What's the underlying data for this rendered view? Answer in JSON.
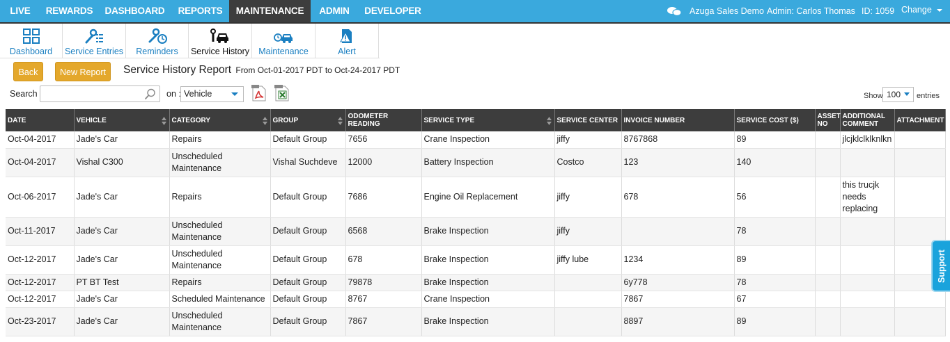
{
  "topnav": {
    "items": [
      {
        "label": "LIVE"
      },
      {
        "label": "REWARDS"
      },
      {
        "label": "DASHBOARD"
      },
      {
        "label": "REPORTS"
      },
      {
        "label": "MAINTENANCE"
      },
      {
        "label": "ADMIN"
      },
      {
        "label": "DEVELOPER"
      }
    ],
    "account": "Azuga Sales Demo",
    "admin": "Admin: Carlos Thomas",
    "id": "ID: 1059",
    "change": "Change"
  },
  "toolbar": {
    "items": [
      {
        "label": "Dashboard",
        "icon": "grid-icon"
      },
      {
        "label": "Service Entries",
        "icon": "wrench-list-icon"
      },
      {
        "label": "Reminders",
        "icon": "wrench-clock-icon"
      },
      {
        "label": "Service History",
        "icon": "car-wrench-icon"
      },
      {
        "label": "Maintenance",
        "icon": "clock-car-icon"
      },
      {
        "label": "Alert",
        "icon": "alert-doc-icon"
      }
    ]
  },
  "actions": {
    "back": "Back",
    "new_report": "New Report"
  },
  "report": {
    "title": "Service History Report",
    "range": "From Oct-01-2017 PDT to Oct-24-2017 PDT"
  },
  "search": {
    "label": "Search :",
    "value": "",
    "on_label": "on :",
    "on_value": "Vehicle"
  },
  "paging": {
    "show_label": "Show",
    "show_value": "100",
    "entries_label": "entries"
  },
  "table": {
    "columns": [
      "DATE",
      "VEHICLE",
      "CATEGORY",
      "GROUP",
      "ODOMETER READING",
      "SERVICE TYPE",
      "SERVICE CENTER",
      "INVOICE NUMBER",
      "SERVICE COST ($)",
      "ASSET NO",
      "ADDITIONAL COMMENT",
      "ATTACHMENT"
    ],
    "rows": [
      [
        "Oct-04-2017",
        "Jade's Car",
        "Repairs",
        "Default Group",
        "7656",
        "Crane Inspection",
        "jiffy",
        "8767868",
        "89",
        "",
        "jlcjklclklknlkn",
        ""
      ],
      [
        "Oct-04-2017",
        "Vishal C300",
        "Unscheduled Maintenance",
        "Vishal Suchdeve",
        "12000",
        "Battery Inspection",
        "Costco",
        "123",
        "140",
        "",
        "",
        ""
      ],
      [
        "Oct-06-2017",
        "Jade's Car",
        "Repairs",
        "Default Group",
        "7686",
        "Engine Oil Replacement",
        "jiffy",
        "678",
        "56",
        "",
        "this trucjk needs replacing",
        ""
      ],
      [
        "Oct-11-2017",
        "Jade's Car",
        "Unscheduled Maintenance",
        "Default Group",
        "6568",
        "Brake Inspection",
        "jiffy",
        "",
        "78",
        "",
        "",
        ""
      ],
      [
        "Oct-12-2017",
        "Jade's Car",
        "Unscheduled Maintenance",
        "Default Group",
        "678",
        "Brake Inspection",
        "jiffy lube",
        "1234",
        "89",
        "",
        "",
        ""
      ],
      [
        "Oct-12-2017",
        "PT BT Test",
        "Repairs",
        "Default Group",
        "79878",
        "Brake Inspection",
        "",
        "6y778",
        "78",
        "",
        "",
        ""
      ],
      [
        "Oct-12-2017",
        "Jade's Car",
        "Scheduled Maintenance",
        "Default Group",
        "8767",
        "Crane Inspection",
        "",
        "7867",
        "67",
        "",
        "",
        ""
      ],
      [
        "Oct-23-2017",
        "Jade's Car",
        "Unscheduled Maintenance",
        "Default Group",
        "7867",
        "Brake Inspection",
        "",
        "8897",
        "89",
        "",
        "",
        ""
      ]
    ]
  },
  "support": "Support",
  "colors": {
    "nav": "#3aa9dd",
    "active_nav": "#3d3d3d",
    "button": "#e4a82c",
    "header": "#3d3d3d",
    "link": "#1a7fc1"
  }
}
